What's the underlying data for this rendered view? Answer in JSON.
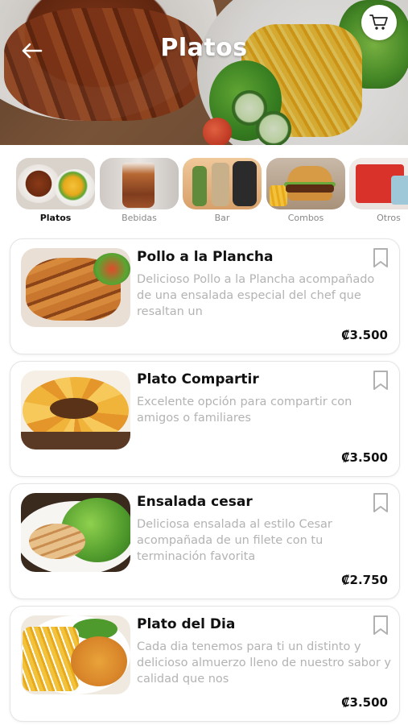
{
  "header": {
    "title": "Platos",
    "back_icon": "arrow-left-icon",
    "cart_icon": "shopping-cart-icon"
  },
  "categories": [
    {
      "label": "Platos",
      "active": true
    },
    {
      "label": "Bebidas",
      "active": false
    },
    {
      "label": "Bar",
      "active": false
    },
    {
      "label": "Combos",
      "active": false
    },
    {
      "label": "Otros",
      "active": false
    }
  ],
  "products": [
    {
      "name": "Pollo a la Plancha",
      "description": "Delicioso Pollo a la Plancha acompañado de una ensalada especial del chef que resaltan un",
      "price": "₡3.500",
      "bookmark_icon": "bookmark-icon"
    },
    {
      "name": "Plato Compartir",
      "description": "Excelente opción para compartir con amigos o familiares",
      "price": "₡3.500",
      "bookmark_icon": "bookmark-icon"
    },
    {
      "name": "Ensalada cesar",
      "description": "Deliciosa ensalada al estilo Cesar acompañada de un filete con tu terminación favorita",
      "price": "₡2.750",
      "bookmark_icon": "bookmark-icon"
    },
    {
      "name": "Plato del Dia",
      "description": "Cada dia tenemos para ti un distinto y delicioso almuerzo lleno de nuestro sabor y calidad que nos",
      "price": "₡3.500",
      "bookmark_icon": "bookmark-icon"
    }
  ],
  "colors": {
    "text_primary": "#111111",
    "text_muted": "#b3b3b3",
    "card_border": "#e4e4e4"
  }
}
